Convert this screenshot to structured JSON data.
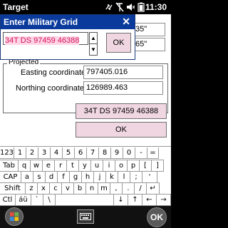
{
  "status_bar": {
    "app_title": "Target",
    "icons": [
      "sync-arrows-icon",
      "no-signal-icon",
      "volume-off-icon",
      "battery-icon"
    ],
    "time": "11:30"
  },
  "form": {
    "partial_field_1": "35\"",
    "partial_field_2": "65\"",
    "group_label": "Projected",
    "easting_label": "Easting coordinate:",
    "easting_value": "797405.016",
    "northing_label": "Northing coordinate:",
    "northing_value": "126989.463",
    "grid_button": "34T DS 97459 46388",
    "ok_button": "OK"
  },
  "dialog": {
    "title": "Enter Military Grid",
    "close": "✕",
    "input_value": "34T DS 97459 46388",
    "ok_button": "OK"
  },
  "keyboard": {
    "rows": [
      [
        "123",
        "1",
        "2",
        "3",
        "4",
        "5",
        "6",
        "7",
        "8",
        "9",
        "0",
        "-",
        "="
      ],
      [
        "Tab",
        "q",
        "w",
        "e",
        "r",
        "t",
        "y",
        "u",
        "i",
        "o",
        "p",
        "[",
        "]"
      ],
      [
        "CAP",
        "a",
        "s",
        "d",
        "f",
        "g",
        "h",
        "j",
        "k",
        "l",
        ";",
        "'"
      ],
      [
        "Shift",
        "z",
        "x",
        "c",
        "v",
        "b",
        "n",
        "m",
        ",",
        ".",
        "/",
        "↵"
      ],
      [
        "Ctl",
        "áü",
        "`",
        "\\",
        "",
        "↓",
        "↑",
        "←",
        "→"
      ]
    ]
  },
  "softkeys": {
    "left": "windows-start-icon",
    "center": "keyboard-icon",
    "right": "OK"
  }
}
